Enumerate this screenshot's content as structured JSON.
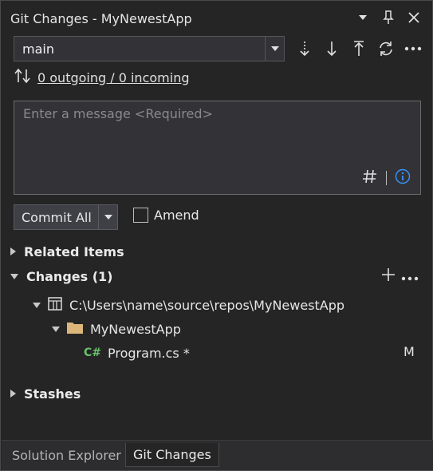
{
  "window": {
    "title": "Git Changes - MyNewestApp",
    "icons": [
      "chevron-down-icon",
      "pin-icon",
      "close-icon"
    ]
  },
  "branch": {
    "name": "main",
    "actions": [
      "fetch-icon",
      "pull-icon",
      "push-icon",
      "sync-icon",
      "more-icon"
    ]
  },
  "sync": {
    "status": "0 outgoing / 0 incoming"
  },
  "message": {
    "placeholder": "Enter a message <Required>"
  },
  "commit": {
    "label": "Commit All",
    "amend_label": "Amend",
    "amend_checked": false
  },
  "tree": {
    "related_items": "Related Items",
    "changes": "Changes (1)",
    "repo_path": "C:\\Users\\name\\source\\repos\\MyNewestApp",
    "folder": "MyNewestApp",
    "file_icon": "C#",
    "file": "Program.cs *",
    "file_status": "M",
    "stashes": "Stashes"
  },
  "tabs": [
    {
      "label": "Solution Explorer",
      "active": false
    },
    {
      "label": "Git Changes",
      "active": true
    }
  ],
  "colors": {
    "background": "#252526",
    "accent_info": "#3794ff",
    "folder": "#dcb67a",
    "csharp": "#68c36b"
  }
}
